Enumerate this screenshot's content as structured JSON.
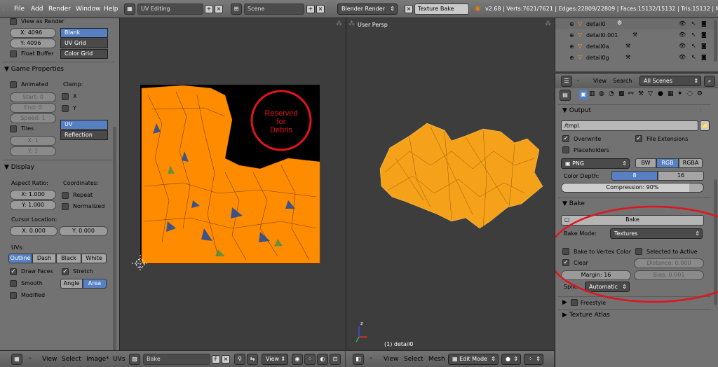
{
  "topbar": {
    "menus": [
      "File",
      "Add",
      "Render",
      "Window",
      "Help"
    ],
    "screen_layout": "UV Editing",
    "scene": "Scene",
    "render_engine": "Blender Render",
    "job": "Texture Bake",
    "stats": "v2.68 | Verts:7621/7621 | Edges:22809/22809 | Faces:15132/15132 | Tris:15132 | M"
  },
  "left_panel": {
    "view_as_render": "View as Render",
    "x_size": "X: 4096",
    "y_size": "Y: 4096",
    "float_buffer": "Float Buffer",
    "gen_types": [
      "Blank",
      "UV Grid",
      "Color Grid"
    ],
    "game_properties": {
      "title": "Game Properties",
      "animated": "Animated",
      "clamp": "Clamp:",
      "start": "Start: 0",
      "end": "End: 0",
      "speed": "Speed: 1",
      "clamp_x": "X",
      "clamp_y": "Y",
      "uv_coordinates": "UV Coordinates",
      "reflection": "Reflection",
      "tiles": "Tiles",
      "tile_x": "X: 1",
      "tile_y": "Y: 1"
    },
    "display": {
      "title": "Display",
      "aspect_ratio": "Aspect Ratio:",
      "coordinates": "Coordinates:",
      "aspect_x": "X: 1.000",
      "aspect_y": "Y: 1.000",
      "repeat": "Repeat",
      "normalized": "Normalized",
      "cursor_location": "Cursor Location:",
      "cursor_x": "X: 0.000",
      "cursor_y": "Y: 0.000",
      "uvs": "UVs:",
      "uv_modes": [
        "Outline",
        "Dash",
        "Black",
        "White"
      ],
      "draw_faces": "Draw Faces",
      "stretch": "Stretch",
      "smooth": "Smooth",
      "stretch_modes": [
        "Angle",
        "Area"
      ],
      "modified": "Modified"
    }
  },
  "uv_editor": {
    "annotation_text": "Reserved\nfor\nDebris",
    "header": {
      "view": "View",
      "select": "Select",
      "image": "Image*",
      "uvs": "UVs",
      "image_name": "Bake",
      "fake_user": "F",
      "view_drop": "View"
    }
  },
  "viewport": {
    "label": "User Persp",
    "object_label": "(1) detail0",
    "header": {
      "view": "View",
      "select": "Select",
      "mesh": "Mesh",
      "mode": "Edit Mode"
    }
  },
  "outliner": {
    "items": [
      "detail0",
      "detail0.001",
      "detail0a",
      "detail0g"
    ],
    "view": "View",
    "search": "Search",
    "scenes": "All Scenes"
  },
  "properties": {
    "output": {
      "title": "Output",
      "path": "/tmp\\",
      "overwrite": "Overwrite",
      "file_extensions": "File Extensions",
      "placeholders": "Placeholders",
      "format": "PNG",
      "color_modes": [
        "BW",
        "RGB",
        "RGBA"
      ],
      "color_depth_label": "Color Depth:",
      "depths": [
        "8",
        "16"
      ],
      "compression": "Compression: 90%",
      "compression_value": 0.9
    },
    "bake": {
      "title": "Bake",
      "bake_button": "Bake",
      "bake_mode_label": "Bake Mode:",
      "bake_mode": "Textures",
      "bake_to_vertex_color": "Bake to Vertex Color",
      "selected_to_active": "Selected to Active",
      "clear": "Clear",
      "distance": "Distance: 0.000",
      "margin": "Margin: 16",
      "bias": "Bias: 0.001",
      "split_label": "Split:",
      "split": "Automatic"
    },
    "freestyle": "Freestyle",
    "texture_atlas": "Texture Atlas"
  },
  "colors": {
    "uv_orange": "#ff8c00",
    "mesh_orange": "#f5a21a",
    "red_annotation": "#e0141e",
    "selected_blue": "#5680c2"
  }
}
